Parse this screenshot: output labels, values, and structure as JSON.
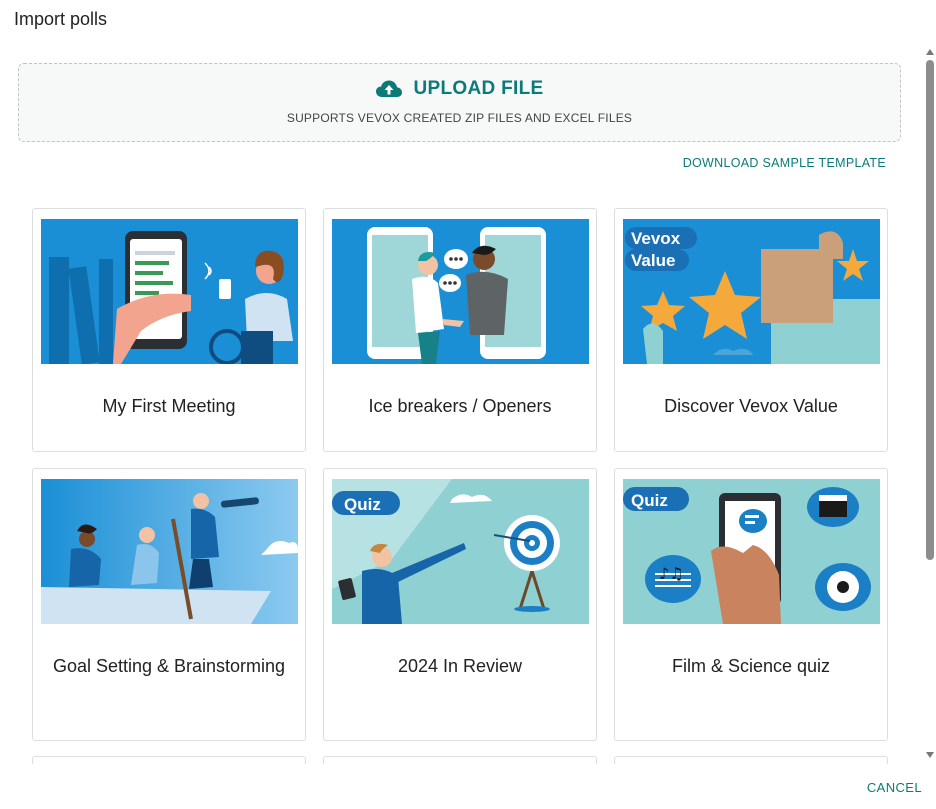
{
  "dialog": {
    "title": "Import polls",
    "cancel_label": "CANCEL"
  },
  "upload": {
    "icon": "cloud-upload-icon",
    "label": "UPLOAD FILE",
    "subtitle": "SUPPORTS VEVOX CREATED ZIP FILES AND EXCEL FILES"
  },
  "download_template_label": "DOWNLOAD SAMPLE TEMPLATE",
  "templates": [
    {
      "name": "My First Meeting"
    },
    {
      "name": "Ice breakers / Openers"
    },
    {
      "name": "Discover Vevox Value",
      "badge": "Vevox Value"
    },
    {
      "name": "Goal Setting & Brainstorming"
    },
    {
      "name": "2024 In Review",
      "badge": "Quiz"
    },
    {
      "name": "Film & Science quiz",
      "badge": "Quiz"
    }
  ],
  "colors": {
    "accent": "#0c7a78",
    "image_blue": "#1b8fd6",
    "image_teal": "#8fd0d2"
  }
}
